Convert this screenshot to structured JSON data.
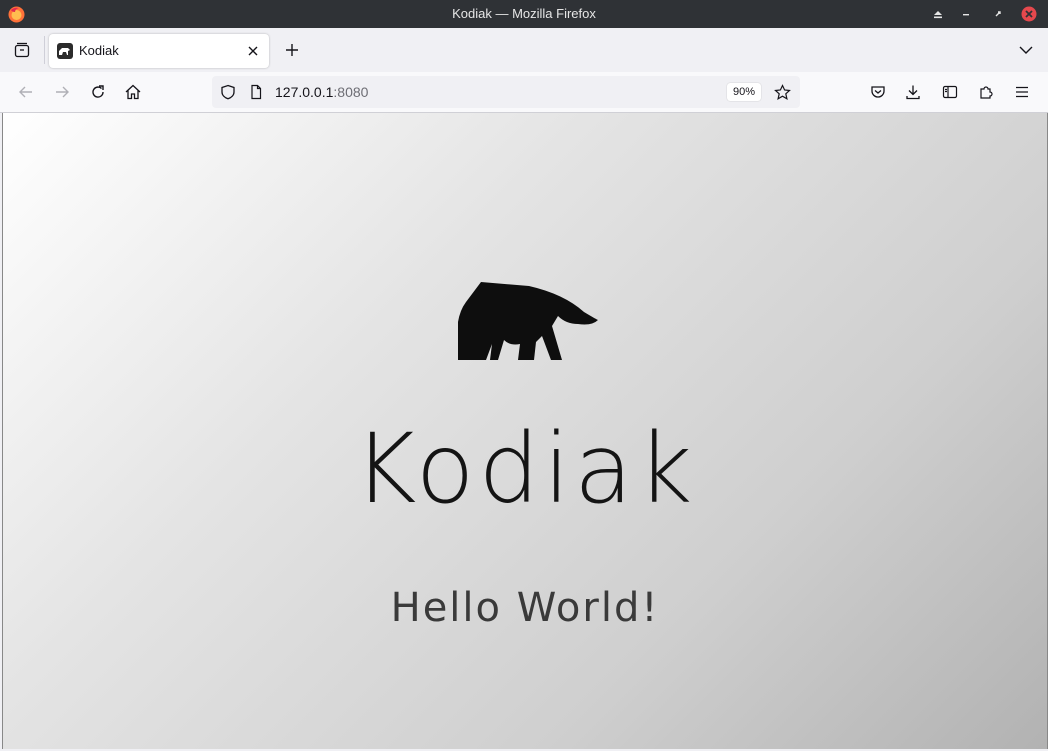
{
  "window": {
    "title": "Kodiak — Mozilla Firefox"
  },
  "tabs": [
    {
      "label": "Kodiak",
      "active": true
    }
  ],
  "navbar": {
    "url_host": "127.0.0.1",
    "url_port": ":8080",
    "zoom": "90%"
  },
  "page": {
    "brand": "Kodiak",
    "greeting": "Hello World!"
  },
  "colors": {
    "titlebar": "#2f3236",
    "close_red": "#e5484d",
    "text": "#15141a"
  },
  "icons": {
    "app": "firefox-icon",
    "tab_favicon": "bear-icon",
    "close": "close-icon",
    "new_tab": "plus-icon",
    "tab_list": "chevron-down-icon",
    "back": "arrow-left-icon",
    "forward": "arrow-right-icon",
    "reload": "reload-icon",
    "home": "home-icon",
    "tracking": "shield-icon",
    "page_info": "page-icon",
    "bookmark": "star-icon",
    "pocket": "pocket-icon",
    "downloads": "download-icon",
    "sidebar": "sidebar-icon",
    "extensions": "puzzle-icon",
    "menu": "hamburger-icon"
  }
}
